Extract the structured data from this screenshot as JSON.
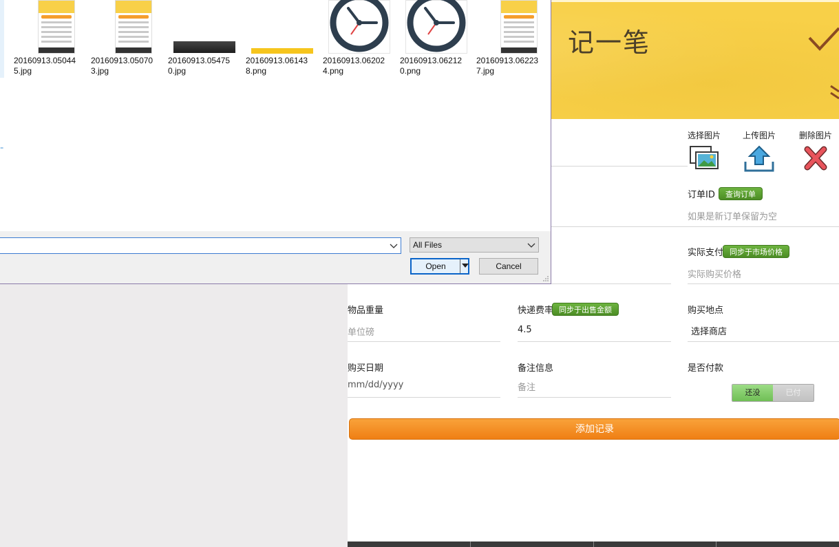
{
  "app": {
    "title": "记一笔",
    "image_actions": {
      "choose": "选择图片",
      "upload": "上传图片",
      "delete": "删除图片"
    },
    "order": {
      "label": "订单ID",
      "query_button": "查询订单",
      "placeholder": "如果是新订单保留为空"
    },
    "actual_pay": {
      "label": "实际支付",
      "sync_button": "同步于市场价格",
      "placeholder": "实际购买价格"
    },
    "weight": {
      "label": "物品重量",
      "placeholder": "单位磅"
    },
    "shipping": {
      "label": "快递费率",
      "sync_button": "同步于出售金额",
      "value": "4.5"
    },
    "place": {
      "label": "购买地点",
      "value": "选择商店"
    },
    "date": {
      "label": "购买日期",
      "placeholder": "mm/dd/yyyy"
    },
    "note": {
      "label": "备注信息",
      "placeholder": "备注"
    },
    "paid": {
      "label": "是否付款",
      "option_no": "还没",
      "option_yes": "已付"
    },
    "add_button": "添加记录"
  },
  "dialog": {
    "files": [
      {
        "name": "20160913.050445.jpg",
        "kind": "phone-screenshot"
      },
      {
        "name": "20160913.050703.jpg",
        "kind": "phone-screenshot"
      },
      {
        "name": "20160913.054750.jpg",
        "kind": "dark-bar"
      },
      {
        "name": "20160913.061438.png",
        "kind": "yellow-bar"
      },
      {
        "name": "20160913.062024.png",
        "kind": "clock-icon"
      },
      {
        "name": "20160913.062120.png",
        "kind": "clock-icon"
      },
      {
        "name": "20160913.062237.jpg",
        "kind": "phone-screenshot"
      }
    ],
    "filename_value": "",
    "filetype": "All Files",
    "open_button": "Open",
    "cancel_button": "Cancel"
  },
  "colors": {
    "header_yellow": "#f8d048",
    "accent_green": "#5aa031",
    "accent_orange": "#f28a1e",
    "dialog_focus_blue": "#0a64c8"
  }
}
